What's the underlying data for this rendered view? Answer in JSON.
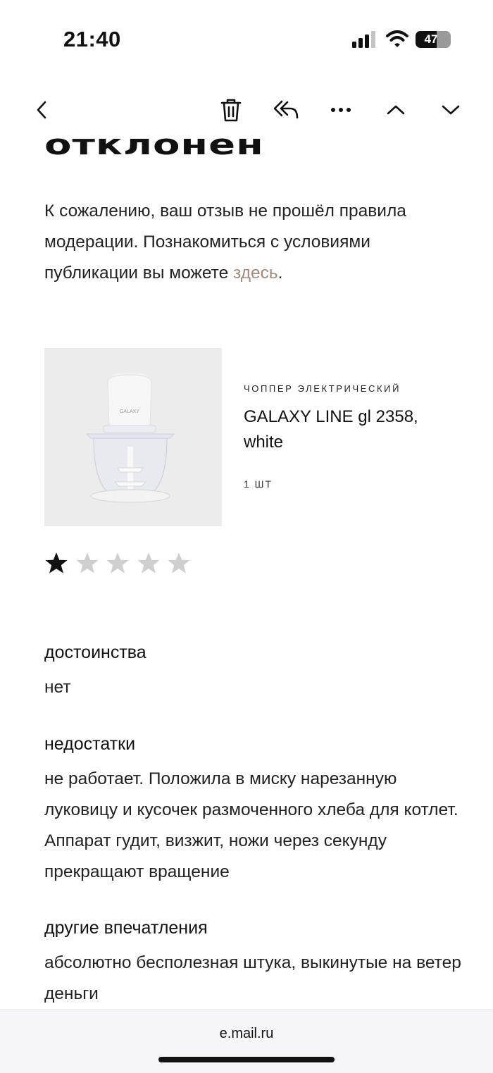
{
  "status_bar": {
    "time": "21:40",
    "battery": "47"
  },
  "toolbar": {
    "icons": [
      "chevron-left-icon",
      "trash-icon",
      "reply-all-icon",
      "more-icon",
      "chevron-up-icon",
      "chevron-down-icon"
    ]
  },
  "email": {
    "heading": "отклонен",
    "intro_text": "К сожалению, ваш отзыв не прошёл правила модерации. Познакомиться с условиями публикации вы можете ",
    "intro_link": "здесь",
    "intro_end": "."
  },
  "product": {
    "category": "ЧОППЕР ЭЛЕКТРИЧЕСКИЙ",
    "name": "GALAXY LINE gl 2358, white",
    "quantity": "1 ШТ",
    "brand_on_image": "GALAXY"
  },
  "rating": {
    "value": 1,
    "max": 5,
    "filled_color": "#111111",
    "empty_color": "#cfcfcf"
  },
  "review": {
    "pros_title": "достоинства",
    "pros_text": "нет",
    "cons_title": "недостатки",
    "cons_text": "не работает. Положила в миску нарезанную луковицу и кусочек размоченного хлеба для котлет. Аппарат гудит, визжит, ножи через секунду прекращают вращение",
    "other_title": "другие впечатления",
    "other_text": "абсолютно бесполезная штука, выкинутые на ветер деньги"
  },
  "browser": {
    "url": "e.mail.ru"
  },
  "colors": {
    "link": "#a28b7a",
    "text": "#222222"
  }
}
